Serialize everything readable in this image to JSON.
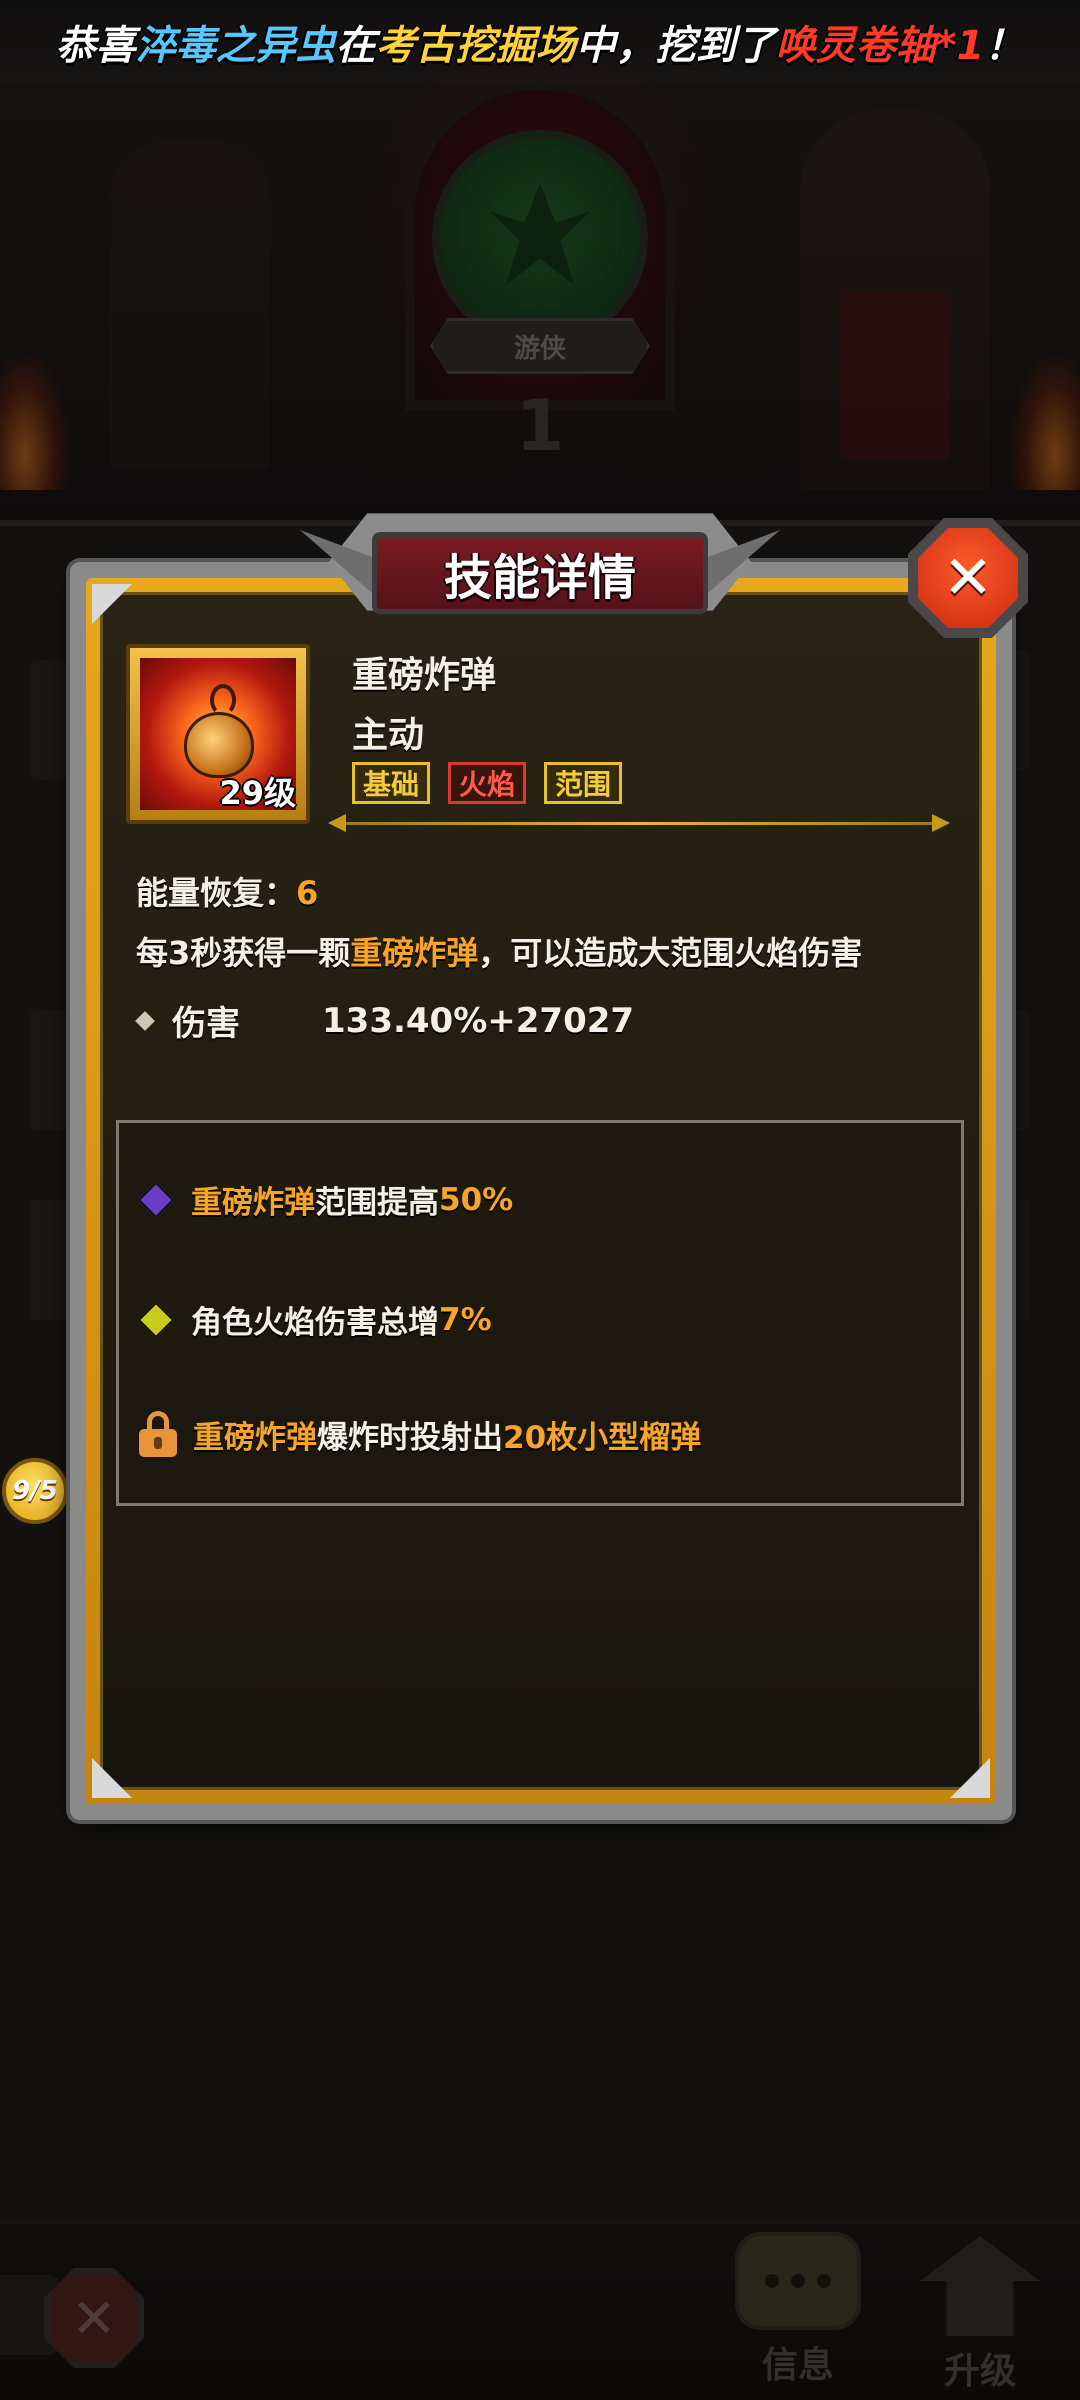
{
  "announcement": {
    "prefix": "恭喜",
    "player": "淬毒之异虫",
    "mid1": "在",
    "location": "考古挖掘场",
    "mid2": "中，挖到了",
    "item": "唤灵卷轴*1",
    "suffix": "！"
  },
  "background": {
    "class_name": "游侠",
    "class_level": "1"
  },
  "side": {
    "progress_badge": "9/5"
  },
  "dialog": {
    "title": "技能详情",
    "close_symbol": "✕",
    "skill": {
      "name": "重磅炸弹",
      "type": "主动",
      "level": "29级",
      "icon": "bomb-icon",
      "tags": [
        "基础",
        "火焰",
        "范围"
      ]
    },
    "energy": {
      "label": "能量恢复：",
      "value": "6"
    },
    "description": {
      "part1": "每3秒获得一颗",
      "highlight": "重磅炸弹",
      "part2": "，可以造成大范围火焰伤害"
    },
    "damage": {
      "label": "伤害",
      "value": "133.40%+27027"
    },
    "upgrades": [
      {
        "icon": "purple-diamond-icon",
        "highlight1": "重磅炸弹",
        "text": "范围提高",
        "highlight2": "50%"
      },
      {
        "icon": "yellow-diamond-icon",
        "text": "角色火焰伤害总增",
        "highlight2": "7%"
      },
      {
        "icon": "lock-icon",
        "highlight1": "重磅炸弹",
        "text": "爆炸时投射出",
        "highlight2": "20枚小型榴弹"
      }
    ]
  },
  "bottom_bar": {
    "close_symbol": "✕",
    "info_label": "信息",
    "upgrade_label": "升级"
  },
  "colors": {
    "gold_frame": "#e6a81c",
    "highlight_orange": "#f6a52a",
    "title_red": "#7a1c24",
    "close_red": "#e0401a"
  }
}
